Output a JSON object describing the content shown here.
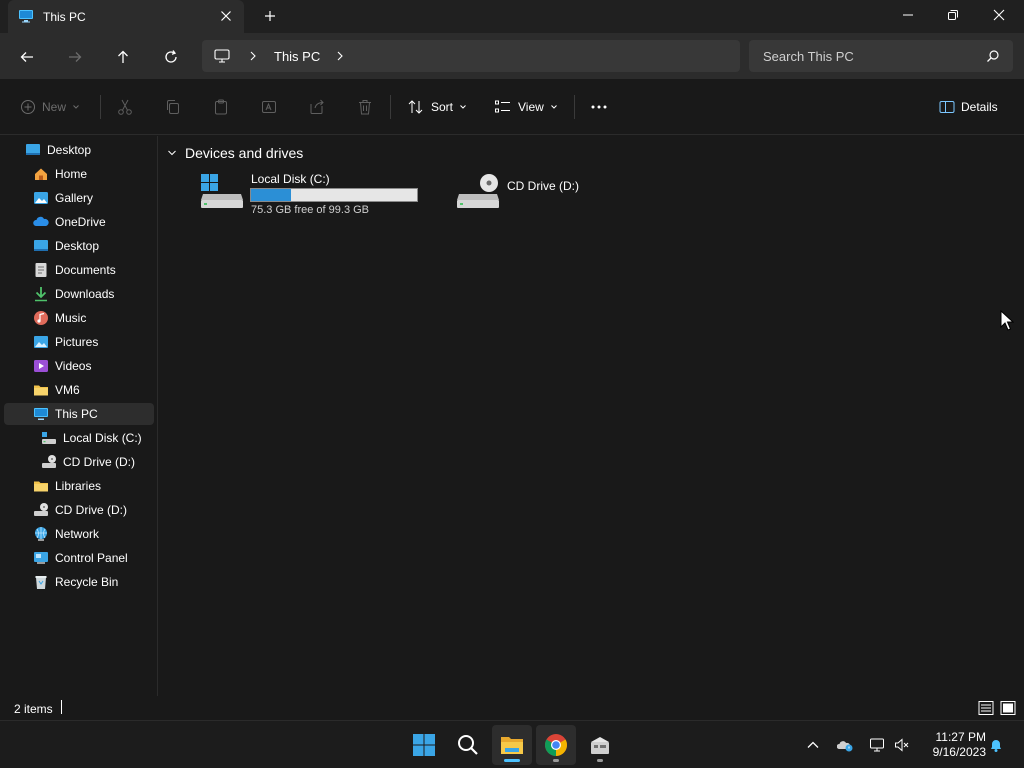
{
  "window": {
    "tab_title": "This PC",
    "tab_icon": "monitor-icon"
  },
  "address": {
    "breadcrumb": [
      "This PC"
    ],
    "search_placeholder": "Search This PC"
  },
  "commandbar": {
    "new_label": "New",
    "sort_label": "Sort",
    "view_label": "View",
    "details_label": "Details"
  },
  "sidebar": {
    "items": [
      {
        "label": "Desktop",
        "icon": "desktop-icon"
      },
      {
        "label": "Home",
        "icon": "home-icon"
      },
      {
        "label": "Gallery",
        "icon": "gallery-icon"
      },
      {
        "label": "OneDrive",
        "icon": "onedrive-icon"
      },
      {
        "label": "Desktop",
        "icon": "desktop-icon"
      },
      {
        "label": "Documents",
        "icon": "documents-icon"
      },
      {
        "label": "Downloads",
        "icon": "downloads-icon"
      },
      {
        "label": "Music",
        "icon": "music-icon"
      },
      {
        "label": "Pictures",
        "icon": "pictures-icon"
      },
      {
        "label": "Videos",
        "icon": "videos-icon"
      },
      {
        "label": "VM6",
        "icon": "folder-icon"
      },
      {
        "label": "This PC",
        "icon": "monitor-icon",
        "selected": true
      },
      {
        "label": "Local Disk (C:)",
        "icon": "drive-icon"
      },
      {
        "label": "CD Drive (D:)",
        "icon": "cd-drive-icon"
      },
      {
        "label": "Libraries",
        "icon": "folder-icon"
      },
      {
        "label": "CD Drive (D:)",
        "icon": "cd-drive-icon"
      },
      {
        "label": "Network",
        "icon": "network-icon"
      },
      {
        "label": "Control Panel",
        "icon": "control-panel-icon"
      },
      {
        "label": "Recycle Bin",
        "icon": "recycle-bin-icon"
      }
    ]
  },
  "content": {
    "group_title": "Devices and drives",
    "drives": [
      {
        "name": "Local Disk (C:)",
        "free_text": "75.3 GB free of 99.3 GB",
        "used_fraction": 0.242,
        "icon": "windows-drive-icon"
      },
      {
        "name": "CD Drive (D:)",
        "icon": "cd-drive-icon"
      }
    ]
  },
  "status": {
    "items_count": "2 items"
  },
  "taskbar": {
    "apps": [
      "start-icon",
      "search-icon",
      "file-explorer-icon",
      "chrome-icon",
      "app-icon"
    ],
    "time": "11:27 PM",
    "date": "9/16/2023"
  },
  "colors": {
    "accent": "#2b8fd6",
    "background": "#191919",
    "chrome": "#202020"
  }
}
